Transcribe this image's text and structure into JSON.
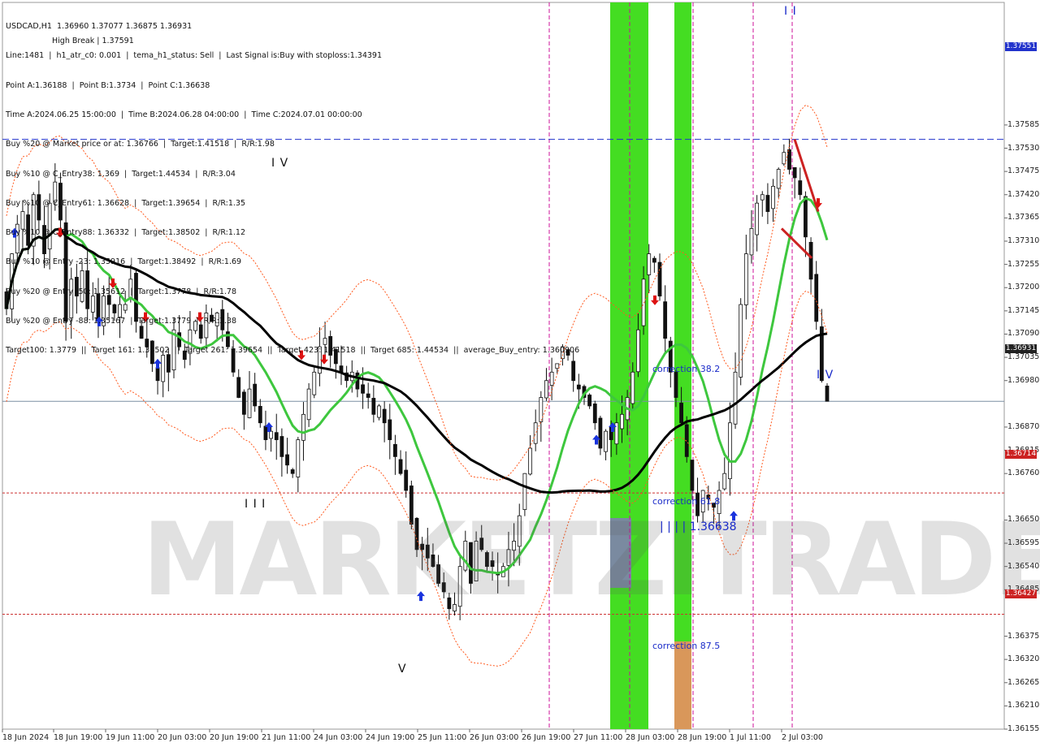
{
  "header": {
    "lines": [
      "USDCAD,H1  1.36960 1.37077 1.36875 1.36931",
      "Line:1481  |  h1_atr_c0: 0.001  |  tema_h1_status: Sell  |  Last Signal is:Buy with stoploss:1.34391",
      "Point A:1.36188  |  Point B:1.3734  |  Point C:1.36638",
      "Time A:2024.06.25 15:00:00  |  Time B:2024.06.28 04:00:00  |  Time C:2024.07.01 00:00:00",
      "Buy %20 @ Market price or at: 1.36766  |  Target:1.41518  |  R/R:1.98",
      "Buy %10 @ C_Entry38: 1.369  |  Target:1.44534  |  R/R:3.04",
      "Buy %10 @ C_Entry61: 1.36628  |  Target:1.39654  |  R/R:1.35",
      "Buy %10 @ C_Entry88: 1.36332  |  Target:1.38502  |  R/R:1.12",
      "Buy %10 @ Entry -23: 1.35916  |  Target:1.38492  |  R/R:1.69",
      "Buy %20 @ Entry -50: 1.35612  |  Target:1.3778  |  R/R:1.78",
      "Buy %20 @ Entry -88: 1.35167  |  Target:1.3779  |  R/R:3.38",
      "Target100: 1.3779  ||  Target 161: 1.38502  ||  Target 261: 1.39654  ||  Target 423: 1.41518  ||  Target 685: 1.44534  ||  average_Buy_entry: 1.360906"
    ],
    "overlay_text": "High Break | 1.37591"
  },
  "watermark": "MARKETZITRADE",
  "colors": {
    "up": "#111111",
    "down": "#111111",
    "ma_black": "#000000",
    "ma_green": "#3ec73e",
    "band": "#ff5a1f",
    "green_zone": "#44dd22",
    "orange_zone": "#d9975a",
    "magenta": "#cc1199",
    "blue_line": "#2233cc",
    "red_line": "#cc2222",
    "buy_arrow": "#1a33dd",
    "sell_arrow": "#dd1111"
  },
  "chart_data": {
    "type": "candlestick",
    "symbol": "USDCAD",
    "timeframe": "H1",
    "ylim": [
      1.36155,
      1.37875
    ],
    "price_axis": [
      "1.37585",
      "1.37530",
      "1.37475",
      "1.37420",
      "1.37365",
      "1.37310",
      "1.37255",
      "1.37200",
      "1.37145",
      "1.37090",
      "1.37035",
      "1.36980",
      "1.36870",
      "1.36815",
      "1.36760",
      "1.36650",
      "1.36595",
      "1.36540",
      "1.36485",
      "1.36375",
      "1.36320",
      "1.36265",
      "1.36210",
      "1.36155"
    ],
    "time_axis": [
      "18 Jun 2024",
      "18 Jun 19:00",
      "19 Jun 11:00",
      "20 Jun 03:00",
      "20 Jun 19:00",
      "21 Jun 11:00",
      "24 Jun 03:00",
      "24 Jun 19:00",
      "25 Jun 11:00",
      "26 Jun 03:00",
      "26 Jun 19:00",
      "27 Jun 11:00",
      "28 Jun 03:00",
      "28 Jun 19:00",
      "1 Jul 11:00",
      "2 Jul 03:00"
    ],
    "last_price": "1.36931",
    "levels": [
      {
        "label": "1.37551",
        "value": 1.37551,
        "style": "blue-dash"
      },
      {
        "label": "1.36931",
        "value": 1.36931,
        "style": "current"
      },
      {
        "label": "1.36714",
        "value": 1.36714,
        "style": "red-dash"
      },
      {
        "label": "1.36427",
        "value": 1.36427,
        "style": "red-dash"
      }
    ],
    "annotations": [
      {
        "text": "correction 38.2",
        "value": 1.3687
      },
      {
        "text": "correction 61.8",
        "value": 1.3661
      },
      {
        "text": "correction 87.5",
        "value": 1.36345
      },
      {
        "text": "| | | | 1.36638",
        "value": 1.36638
      }
    ],
    "wave_labels": [
      "I V",
      "I I I",
      "V",
      "I I",
      "I V"
    ],
    "closes": [
      1.3715,
      1.3728,
      1.3735,
      1.3738,
      1.373,
      1.3742,
      1.3736,
      1.3728,
      1.374,
      1.3745,
      1.3736,
      1.3712,
      1.3722,
      1.3718,
      1.3724,
      1.3715,
      1.3718,
      1.3712,
      1.3718,
      1.3716,
      1.3714,
      1.3716,
      1.3716,
      1.3722,
      1.3712,
      1.3708,
      1.3706,
      1.3702,
      1.3698,
      1.3704,
      1.37,
      1.371,
      1.3706,
      1.3703,
      1.371,
      1.3712,
      1.3708,
      1.3714,
      1.3712,
      1.3714,
      1.371,
      1.3706,
      1.37,
      1.3694,
      1.369,
      1.3696,
      1.3692,
      1.3688,
      1.3684,
      1.3686,
      1.3684,
      1.368,
      1.3678,
      1.3676,
      1.3684,
      1.369,
      1.3696,
      1.37,
      1.3706,
      1.3708,
      1.3704,
      1.3702,
      1.37,
      1.3698,
      1.37,
      1.3696,
      1.3695,
      1.3694,
      1.369,
      1.3692,
      1.3688,
      1.3684,
      1.368,
      1.3676,
      1.3672,
      1.3664,
      1.3658,
      1.3658,
      1.3656,
      1.3654,
      1.365,
      1.3648,
      1.3644,
      1.3645,
      1.3654,
      1.366,
      1.365,
      1.366,
      1.3658,
      1.3654,
      1.3654,
      1.3652,
      1.3654,
      1.3658,
      1.366,
      1.3666,
      1.3676,
      1.3682,
      1.3688,
      1.3694,
      1.3698,
      1.37,
      1.3702,
      1.3706,
      1.3704,
      1.3698,
      1.3696,
      1.3694,
      1.3692,
      1.3688,
      1.3682,
      1.3686,
      1.3684,
      1.3688,
      1.369,
      1.3694,
      1.37,
      1.371,
      1.3722,
      1.3728,
      1.3726,
      1.3718,
      1.3708,
      1.37,
      1.3694,
      1.3688,
      1.368,
      1.3672,
      1.3666,
      1.3672,
      1.367,
      1.3668,
      1.3672,
      1.3676,
      1.3688,
      1.37,
      1.3716,
      1.3728,
      1.3734,
      1.374,
      1.3742,
      1.3738,
      1.3744,
      1.3748,
      1.3752,
      1.3748,
      1.3746,
      1.3742,
      1.3732,
      1.3722,
      1.3712,
      1.3698,
      1.36931
    ]
  }
}
